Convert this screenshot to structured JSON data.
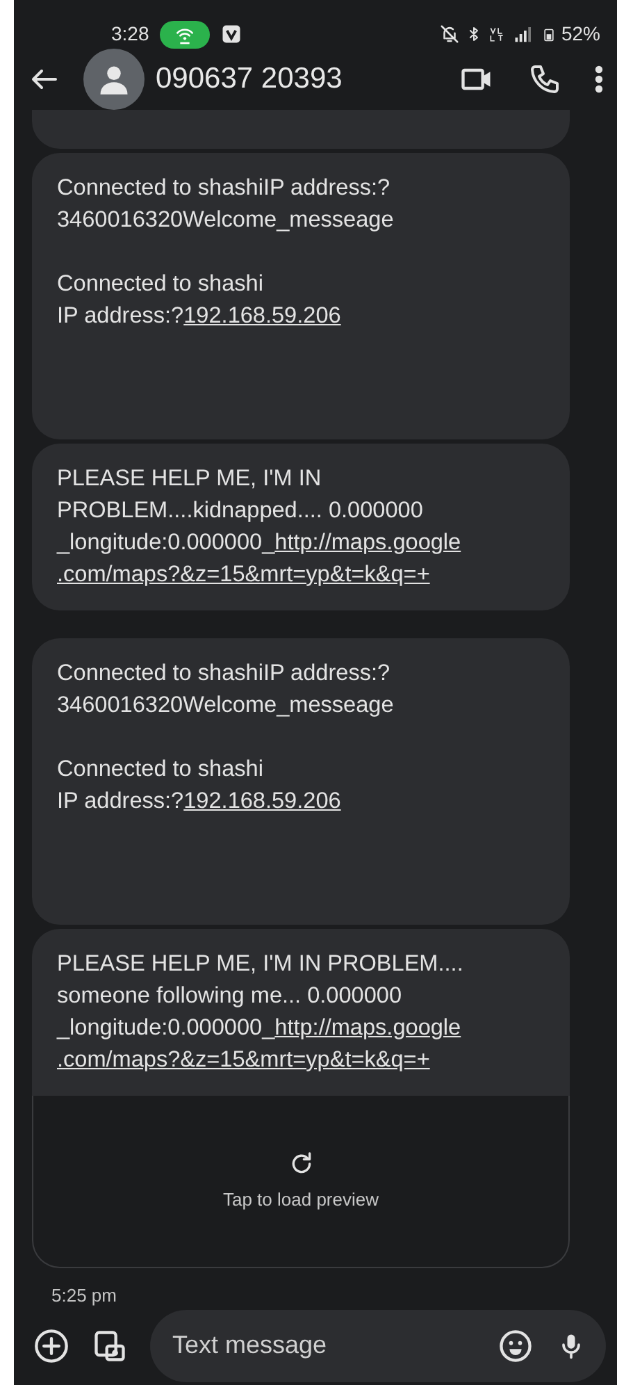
{
  "status_bar": {
    "time": "3:28",
    "battery": "52%"
  },
  "header": {
    "contact": "090637 20393"
  },
  "messages": [
    {
      "kind": "partial"
    },
    {
      "kind": "text",
      "tall": true,
      "paragraphs": [
        {
          "text": "Connected to shashiIP address:?\n3460016320Welcome_messeage"
        },
        {
          "text": "Connected to shashi\nIP address:?",
          "link": "192.168.59.206"
        }
      ]
    },
    {
      "kind": "text",
      "tall": false,
      "paragraphs": [
        {
          "text": "PLEASE HELP ME, I'M IN\nPROBLEM....kidnapped.... 0.000000\n_longitude:0.000000_",
          "link": "http://maps.google\n.com/maps?&z=15&mrt=yp&t=k&q=+"
        }
      ]
    },
    {
      "kind": "text",
      "tall": true,
      "paragraphs": [
        {
          "text": "Connected to shashiIP address:?\n3460016320Welcome_messeage"
        },
        {
          "text": "Connected to shashi\nIP address:?",
          "link": "192.168.59.206"
        }
      ]
    },
    {
      "kind": "text",
      "tall": false,
      "paragraphs": [
        {
          "text": "PLEASE HELP ME, I'M IN PROBLEM....\nsomeone following me... 0.000000\n_longitude:0.000000_",
          "link": "http://maps.google\n.com/maps?&z=15&mrt=yp&t=k&q=+"
        }
      ],
      "preview": {
        "label": "Tap to load preview"
      },
      "time": "5:25 pm"
    }
  ],
  "composer": {
    "placeholder": "Text message"
  }
}
